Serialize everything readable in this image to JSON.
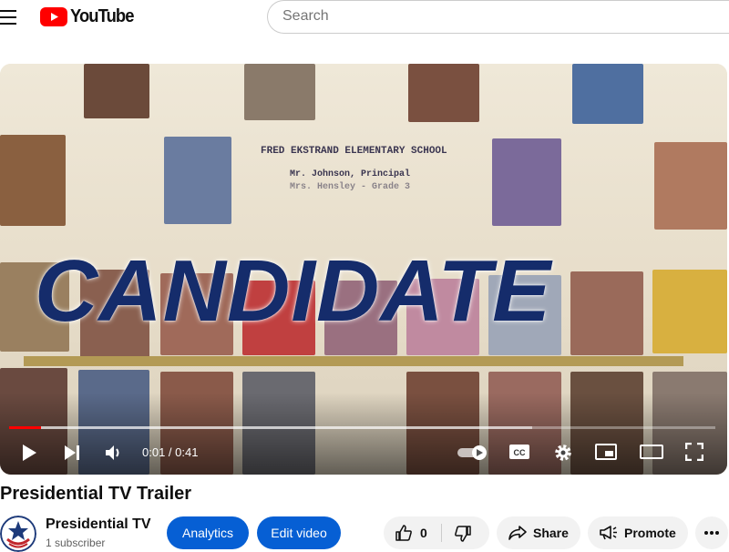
{
  "masthead": {
    "logo_text": "YouTube",
    "search_placeholder": "Search"
  },
  "player": {
    "yearbook": {
      "school": "FRED EKSTRAND ELEMENTARY SCHOOL",
      "principal": "Mr. Johnson, Principal",
      "teacher": "Mrs. Hensley - Grade 3"
    },
    "overlay_title": "CANDIDATE",
    "time_current": "0:01",
    "time_separator": " / ",
    "time_total": "0:41",
    "progress_played_fraction": 0.045,
    "buffered_fraction": 0.74,
    "autoplay_on": true
  },
  "video": {
    "title": "Presidential TV Trailer"
  },
  "channel": {
    "name": "Presidential TV",
    "subscribers": "1 subscriber"
  },
  "actions": {
    "analytics": "Analytics",
    "edit_video": "Edit video",
    "like_count": "0",
    "share": "Share",
    "promote": "Promote"
  },
  "colors": {
    "brand_red": "#ff0000",
    "button_blue": "#065fd4",
    "overlay_navy": "#152c6b",
    "gold_bar": "#b39a55"
  },
  "icons": [
    "menu-icon",
    "youtube-logo-icon",
    "play-icon",
    "next-icon",
    "volume-icon",
    "autoplay-toggle",
    "subtitles-icon",
    "settings-icon",
    "miniplayer-icon",
    "theater-icon",
    "fullscreen-icon",
    "like-icon",
    "dislike-icon",
    "share-icon",
    "promote-icon",
    "more-icon"
  ]
}
